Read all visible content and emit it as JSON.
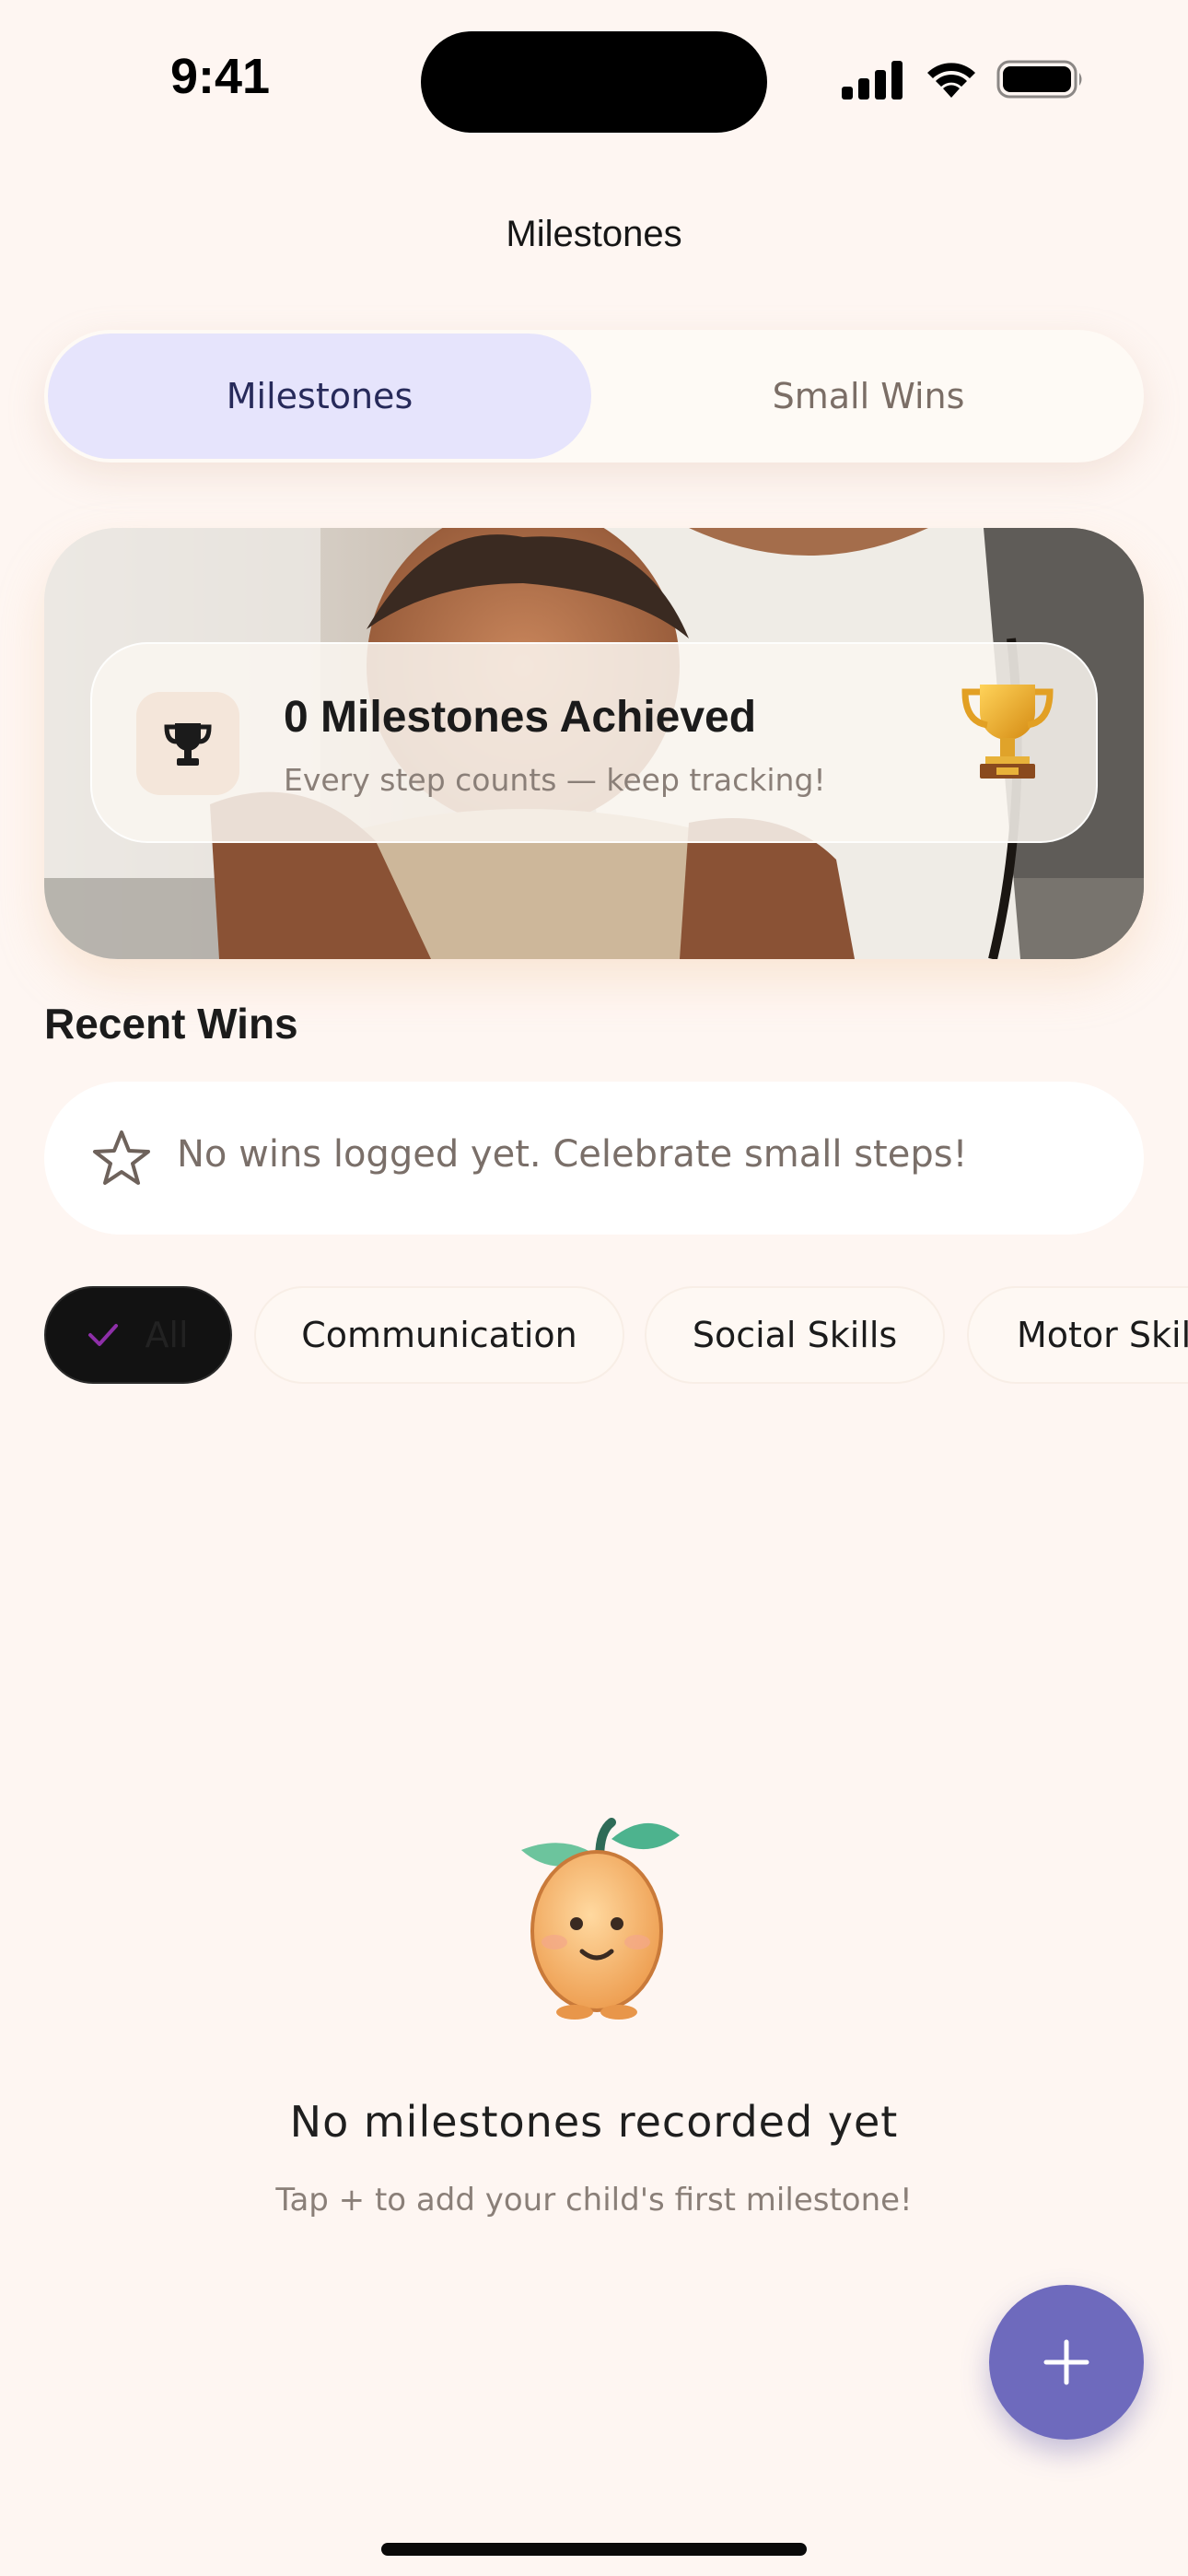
{
  "status_bar": {
    "time": "9:41"
  },
  "header": {
    "title": "Milestones"
  },
  "segmented": {
    "milestones_label": "Milestones",
    "small_wins_label": "Small Wins"
  },
  "hero": {
    "title": "0 Milestones Achieved",
    "subtitle": "Every step counts — keep tracking!"
  },
  "recent_wins": {
    "title": "Recent Wins",
    "empty_text": "No wins logged yet. Celebrate small steps!"
  },
  "filters": {
    "items": [
      "All",
      "Communication",
      "Social Skills",
      "Motor Skil"
    ],
    "selected": "All"
  },
  "empty_state": {
    "title": "No milestones recorded yet",
    "subtitle": "Tap + to add your child's first milestone!"
  },
  "colors": {
    "background": "#FEF6F2",
    "accent": "#6E6ABD",
    "segment_active": "#E6E4FC",
    "chip_selected": "#121212"
  }
}
